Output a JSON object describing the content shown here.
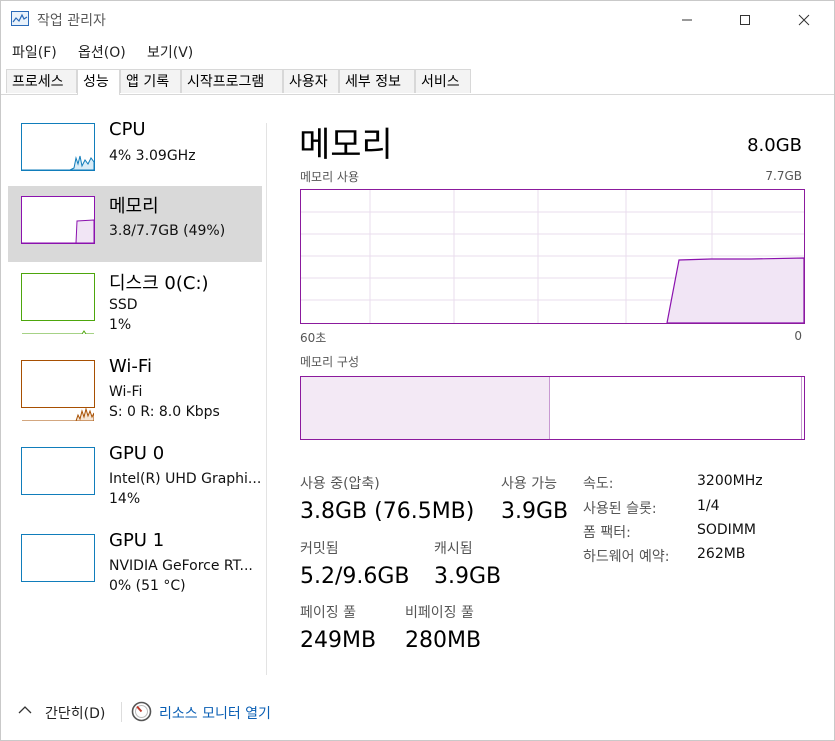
{
  "window": {
    "title": "작업 관리자",
    "minimize_icon": "minimize-icon",
    "maximize_icon": "maximize-icon",
    "close_icon": "close-icon"
  },
  "menu": [
    "파일(F)",
    "옵션(O)",
    "보기(V)"
  ],
  "tabs": [
    "프로세스",
    "성능",
    "앱 기록",
    "시작프로그램",
    "사용자",
    "세부 정보",
    "서비스"
  ],
  "active_tab": "성능",
  "sidebar": [
    {
      "title": "CPU",
      "lines": [
        "4% 3.09GHz"
      ],
      "color": "#117dbb"
    },
    {
      "title": "메모리",
      "lines": [
        "3.8/7.7GB (49%)"
      ],
      "color": "#8b12ae"
    },
    {
      "title": "디스크 0(C:)",
      "lines": [
        "SSD",
        "1%"
      ],
      "color": "#4da60c"
    },
    {
      "title": "Wi-Fi",
      "lines": [
        "Wi-Fi",
        "S: 0 R: 8.0 Kbps"
      ],
      "color": "#a74f01"
    },
    {
      "title": "GPU 0",
      "lines": [
        "Intel(R) UHD Graphi...",
        "14%"
      ],
      "color": "#117dbb"
    },
    {
      "title": "GPU 1",
      "lines": [
        "NVIDIA GeForce RT...",
        "0% (51 °C)"
      ],
      "color": "#117dbb"
    }
  ],
  "main": {
    "title": "메모리",
    "total": "8.0GB",
    "usage_label": "메모리 사용",
    "usage_max": "7.7GB",
    "axis_left": "60초",
    "axis_right": "0",
    "composition_label": "메모리 구성",
    "stats": {
      "in_use_label": "사용 중(압축)",
      "in_use_value": "3.8GB (76.5MB)",
      "available_label": "사용 가능",
      "available_value": "3.9GB",
      "committed_label": "커밋됨",
      "committed_value": "5.2/9.6GB",
      "cached_label": "캐시됨",
      "cached_value": "3.9GB",
      "paged_label": "페이징 풀",
      "paged_value": "249MB",
      "nonpaged_label": "비페이징 풀",
      "nonpaged_value": "280MB"
    },
    "details": [
      {
        "label": "속도:",
        "value": "3200MHz"
      },
      {
        "label": "사용된 슬롯:",
        "value": "1/4"
      },
      {
        "label": "폼 팩터:",
        "value": "SODIMM"
      },
      {
        "label": "하드웨어 예약:",
        "value": "262MB"
      }
    ]
  },
  "footer": {
    "collapse_label": "간단히(D)",
    "monitor_label": "리소스 모니터 열기",
    "collapse_icon": "chevron-up-icon",
    "monitor_icon": "resource-monitor-icon"
  }
}
